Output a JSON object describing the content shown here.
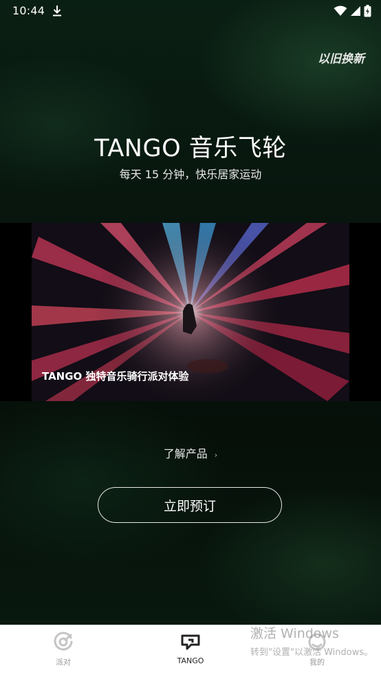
{
  "status_bar": {
    "time": "10:44",
    "icons": [
      "download-icon",
      "wifi-icon",
      "signal-icon",
      "battery-icon"
    ]
  },
  "header": {
    "trade_in_link": "以旧换新"
  },
  "hero": {
    "title": "TANGO 音乐飞轮",
    "subtitle": "每天 15 分钟，快乐居家运动"
  },
  "video": {
    "caption": "TANGO 独特音乐骑行派对体验"
  },
  "learn_more": {
    "label": "了解产品",
    "chevron": "›"
  },
  "cta": {
    "label": "立即预订"
  },
  "tab_bar": {
    "active": 1,
    "items": [
      {
        "label": "派对",
        "icon": "party-icon"
      },
      {
        "label": "TANGO",
        "icon": "tango-icon"
      },
      {
        "label": "我的",
        "icon": "profile-icon"
      }
    ]
  },
  "watermark": {
    "line1": "激活 Windows",
    "line2": "转到\"设置\"以激活 Windows。"
  },
  "colors": {
    "background": "#061109",
    "tab_bar": "#ffffff",
    "active_tab_text": "#222222",
    "inactive_tab_text": "#9a9a9a"
  }
}
